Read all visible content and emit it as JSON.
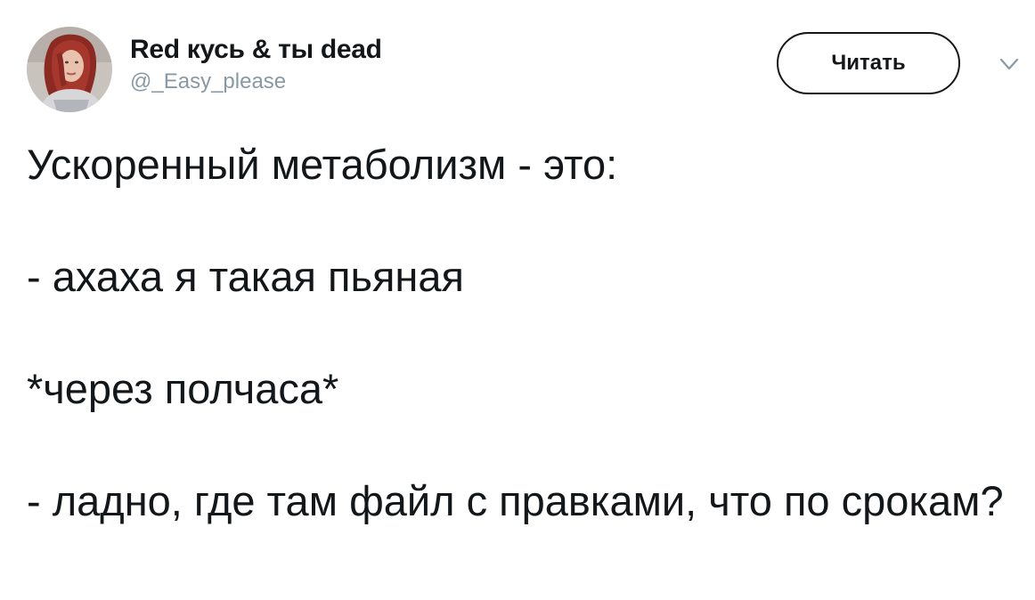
{
  "author": {
    "display_name": "Red кусь & ты dead",
    "handle": "@_Easy_please"
  },
  "follow_button": {
    "label": "Читать"
  },
  "icons": {
    "menu": "chevron-down-icon",
    "avatar": "avatar-photo"
  },
  "colors": {
    "text": "#14171a",
    "handle": "#8899a6",
    "background": "#ffffff"
  },
  "tweet": {
    "lines": [
      "Ускоренный метаболизм - это:",
      "- ахаха я такая пьяная",
      "*через полчаса*",
      "- ладно, где там файл с правками, что по срокам?"
    ]
  }
}
